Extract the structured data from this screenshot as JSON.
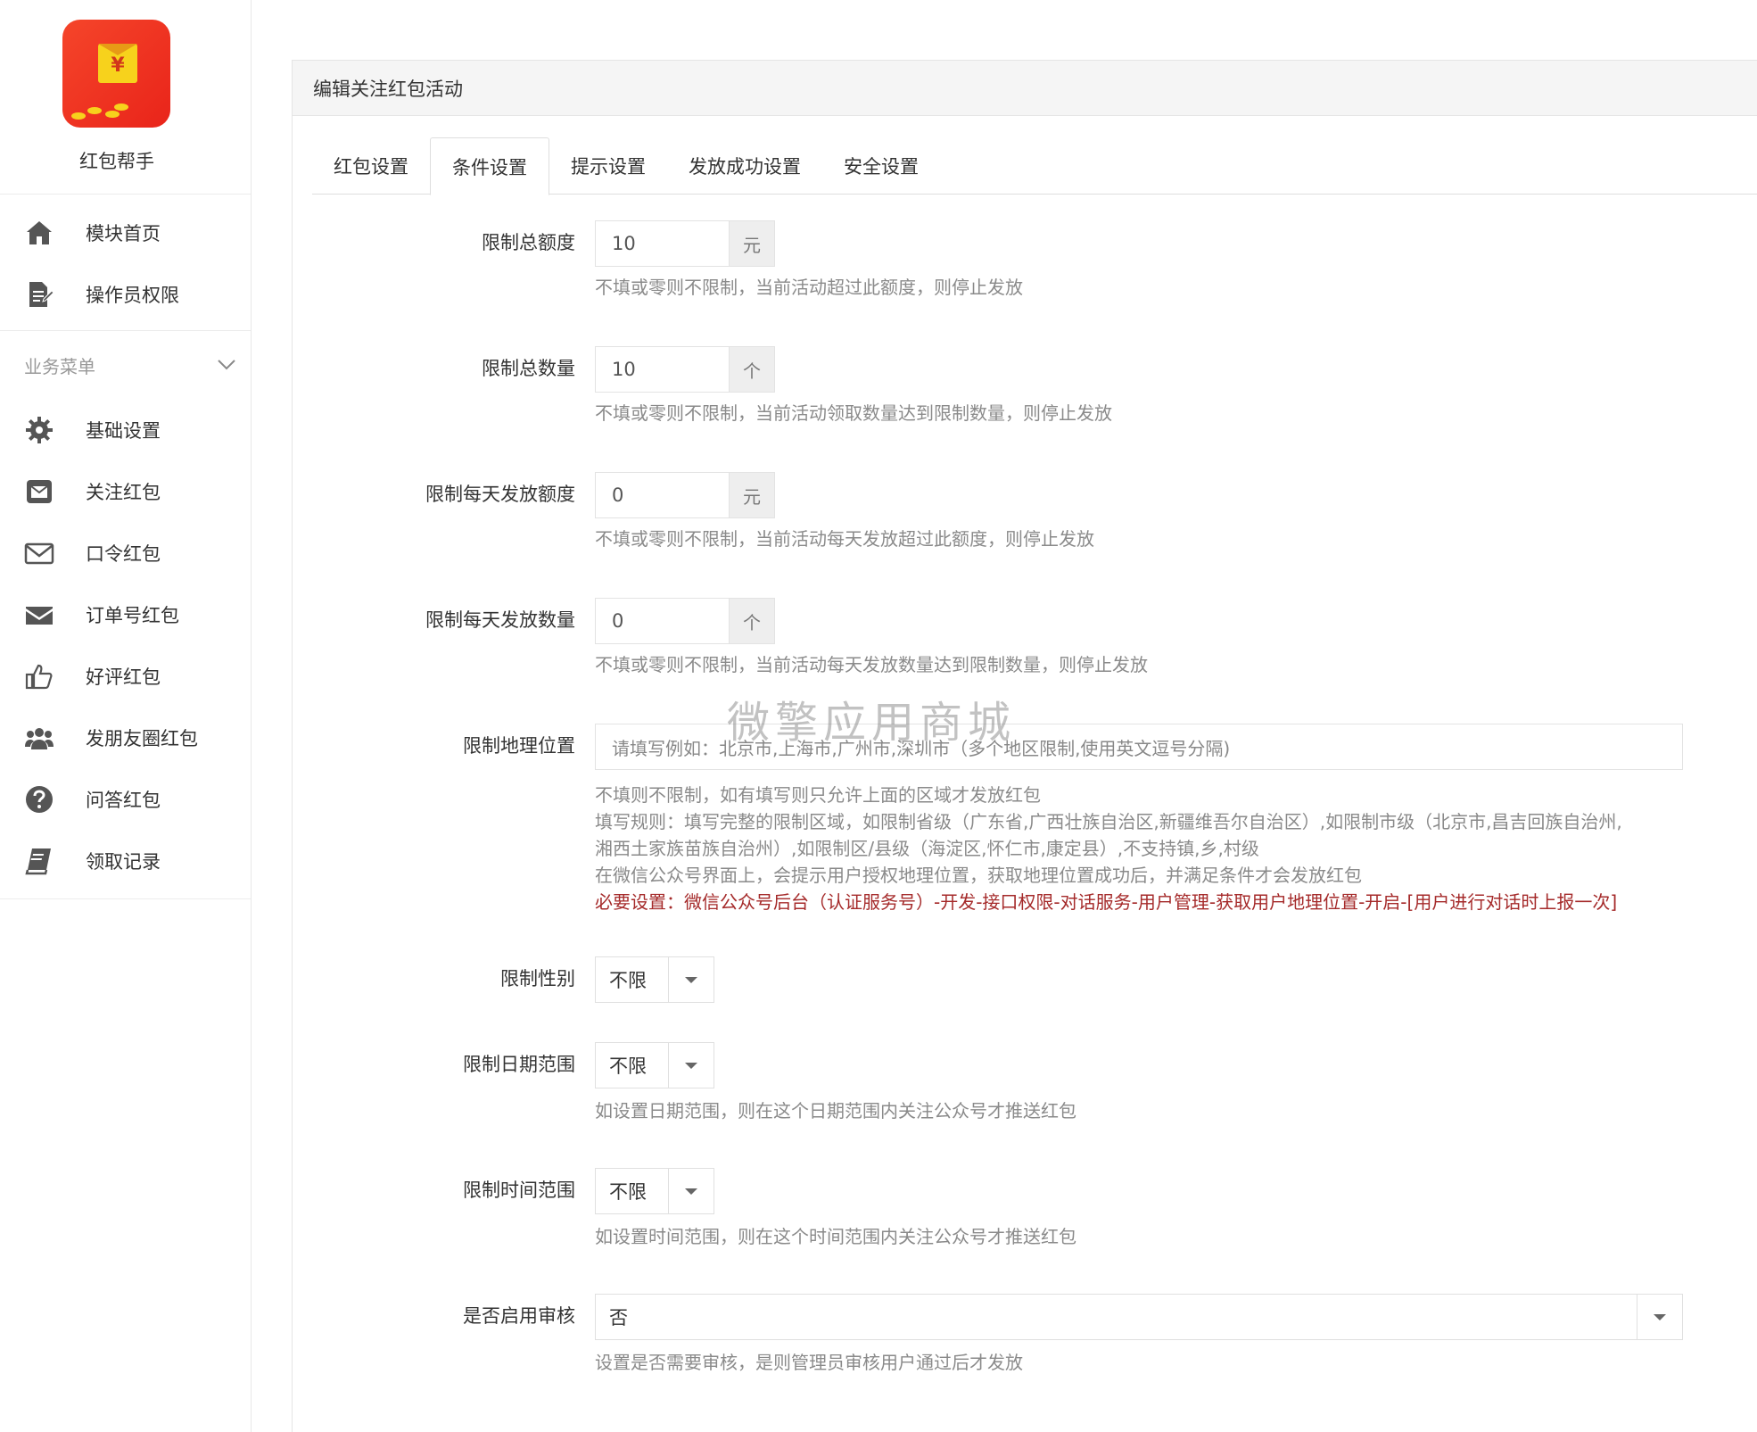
{
  "app": {
    "name": "红包帮手"
  },
  "sidebar": {
    "top_items": [
      {
        "label": "模块首页",
        "icon": "home-icon"
      },
      {
        "label": "操作员权限",
        "icon": "document-edit-icon"
      }
    ],
    "section_title": "业务菜单",
    "items": [
      {
        "label": "基础设置",
        "icon": "gear-icon"
      },
      {
        "label": "关注红包",
        "icon": "envelope-square-icon"
      },
      {
        "label": "口令红包",
        "icon": "envelope-outline-icon"
      },
      {
        "label": "订单号红包",
        "icon": "envelope-solid-icon"
      },
      {
        "label": "好评红包",
        "icon": "thumbs-up-icon"
      },
      {
        "label": "发朋友圈红包",
        "icon": "users-icon"
      },
      {
        "label": "问答红包",
        "icon": "question-circle-icon"
      },
      {
        "label": "领取记录",
        "icon": "book-icon"
      }
    ]
  },
  "panel": {
    "title": "编辑关注红包活动"
  },
  "tabs": [
    {
      "label": "红包设置",
      "active": false
    },
    {
      "label": "条件设置",
      "active": true
    },
    {
      "label": "提示设置",
      "active": false
    },
    {
      "label": "发放成功设置",
      "active": false
    },
    {
      "label": "安全设置",
      "active": false
    }
  ],
  "form": {
    "total_amount": {
      "label": "限制总额度",
      "value": "10",
      "unit": "元",
      "help": "不填或零则不限制，当前活动超过此额度，则停止发放"
    },
    "total_count": {
      "label": "限制总数量",
      "value": "10",
      "unit": "个",
      "help": "不填或零则不限制，当前活动领取数量达到限制数量，则停止发放"
    },
    "daily_amount": {
      "label": "限制每天发放额度",
      "value": "0",
      "unit": "元",
      "help": "不填或零则不限制，当前活动每天发放超过此额度，则停止发放"
    },
    "daily_count": {
      "label": "限制每天发放数量",
      "value": "0",
      "unit": "个",
      "help": "不填或零则不限制，当前活动每天发放数量达到限制数量，则停止发放"
    },
    "location": {
      "label": "限制地理位置",
      "placeholder": "请填写例如：北京市,上海市,广州市,深圳市（多个地区限制,使用英文逗号分隔)",
      "help_lines": [
        "不填则不限制，如有填写则只允许上面的区域才发放红包",
        "填写规则：填写完整的限制区域，如限制省级（广东省,广西壮族自治区,新疆维吾尔自治区）,如限制市级（北京市,昌吉回族自治州,",
        "湘西土家族苗族自治州）,如限制区/县级（海淀区,怀仁市,康定县）,不支持镇,乡,村级",
        "在微信公众号界面上，会提示用户授权地理位置，获取地理位置成功后，并满足条件才会发放红包"
      ],
      "help_required": "必要设置：微信公众号后台（认证服务号）-开发-接口权限-对话服务-用户管理-获取用户地理位置-开启-[用户进行对话时上报一次]"
    },
    "gender": {
      "label": "限制性别",
      "value": "不限"
    },
    "date_range": {
      "label": "限制日期范围",
      "value": "不限",
      "help": "如设置日期范围，则在这个日期范围内关注公众号才推送红包"
    },
    "time_range": {
      "label": "限制时间范围",
      "value": "不限",
      "help": "如设置时间范围，则在这个时间范围内关注公众号才推送红包"
    },
    "review": {
      "label": "是否启用审核",
      "value": "否",
      "help": "设置是否需要审核，是则管理员审核用户通过后才发放"
    }
  },
  "watermark": "微擎应用商城"
}
